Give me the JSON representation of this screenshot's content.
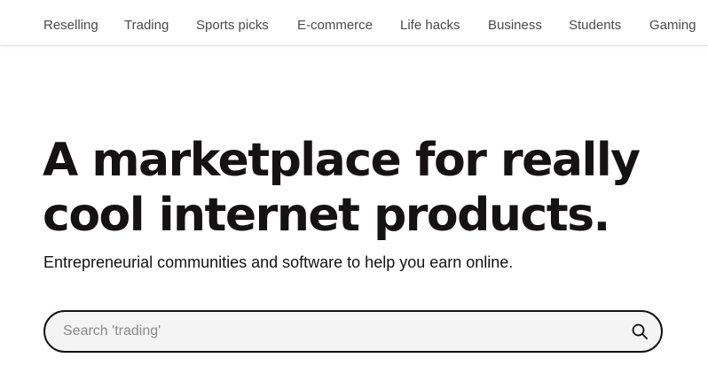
{
  "nav": {
    "items": [
      {
        "label": "Reselling"
      },
      {
        "label": "Trading"
      },
      {
        "label": "Sports picks"
      },
      {
        "label": "E-commerce"
      },
      {
        "label": "Life hacks"
      },
      {
        "label": "Business"
      },
      {
        "label": "Students"
      },
      {
        "label": "Gaming"
      }
    ]
  },
  "hero": {
    "title": "A marketplace for really cool internet products.",
    "subtitle": "Entrepreneurial communities and software to help you earn online."
  },
  "search": {
    "placeholder": "Search 'trading'",
    "value": "",
    "icon": "search-icon"
  },
  "colors": {
    "text": "#141212",
    "nav_text": "#4a4a4a",
    "search_bg": "#f4f4f4"
  }
}
